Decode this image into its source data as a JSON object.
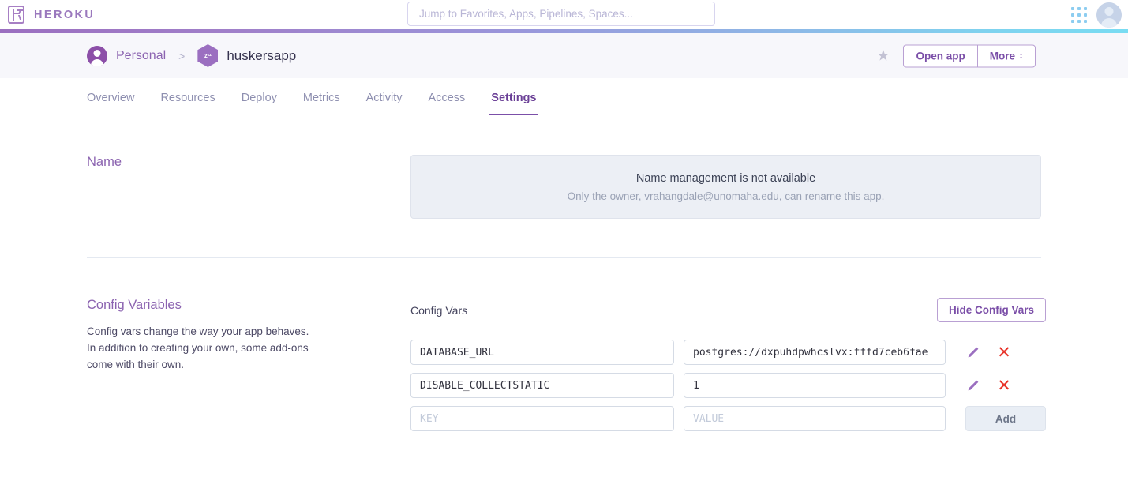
{
  "header": {
    "brand": "HEROKU",
    "logo_icon": "heroku-logo-icon",
    "search": {
      "placeholder": "Jump to Favorites, Apps, Pipelines, Spaces...",
      "value": ""
    },
    "app_switcher_icon": "grid-dots-icon",
    "avatar_icon": "user-avatar-icon",
    "gradient_from": "#9b6fc0",
    "gradient_to": "#79dcf2"
  },
  "app_bar": {
    "breadcrumb": {
      "owner": "Personal",
      "owner_icon": "person-circle-icon",
      "separator": ">",
      "app_name": "huskersapp",
      "app_icon_label": "zᶻᶻ",
      "app_icon": "sleeping-app-hexagon-icon"
    },
    "favorite_icon": "star-icon",
    "open_app_label": "Open app",
    "more_label": "More",
    "more_chevron_icon": "chevron-updown-icon"
  },
  "tabs": [
    {
      "label": "Overview",
      "active": false
    },
    {
      "label": "Resources",
      "active": false
    },
    {
      "label": "Deploy",
      "active": false
    },
    {
      "label": "Metrics",
      "active": false
    },
    {
      "label": "Activity",
      "active": false
    },
    {
      "label": "Access",
      "active": false
    },
    {
      "label": "Settings",
      "active": true
    }
  ],
  "name_section": {
    "title": "Name",
    "notice_title": "Name management is not available",
    "notice_sub": "Only the owner, vrahangdale@unomaha.edu, can rename this app."
  },
  "config_section": {
    "title": "Config Variables",
    "description": "Config vars change the way your app behaves. In addition to creating your own, some add-ons come with their own.",
    "panel_label": "Config Vars",
    "hide_button_label": "Hide Config Vars",
    "rows": [
      {
        "key": "DATABASE_URL",
        "value": "postgres://dxpuhdpwhcslvx:fffd7ceb6fae",
        "edit_icon": "pencil-icon",
        "delete_icon": "x-close-icon"
      },
      {
        "key": "DISABLE_COLLECTSTATIC",
        "value": "1",
        "edit_icon": "pencil-icon",
        "delete_icon": "x-close-icon"
      }
    ],
    "new_row": {
      "key_placeholder": "KEY",
      "value_placeholder": "VALUE",
      "key_value": "",
      "value_value": "",
      "add_label": "Add"
    }
  },
  "colors": {
    "brand_purple": "#7b4fa8",
    "accent_purple": "#9b6fc0",
    "danger_red": "#e8342a",
    "panel_bg": "#eceff5"
  }
}
